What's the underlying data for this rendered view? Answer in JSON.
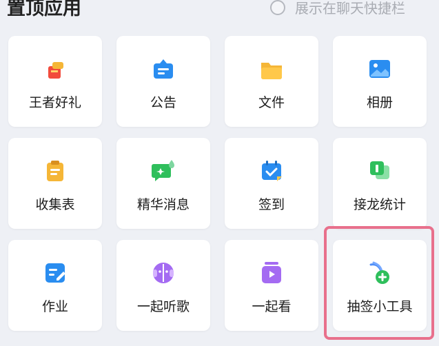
{
  "header": {
    "title": "置顶应用",
    "toggle_label": "展示在聊天快捷栏"
  },
  "apps": [
    {
      "label": "王者好礼",
      "icon": "gift-icon",
      "color": "#f24b3c"
    },
    {
      "label": "公告",
      "icon": "announcement-icon",
      "color": "#2a8df0"
    },
    {
      "label": "文件",
      "icon": "folder-icon",
      "color": "#f5b637"
    },
    {
      "label": "相册",
      "icon": "photo-album-icon",
      "color": "#2a8df0"
    },
    {
      "label": "收集表",
      "icon": "clipboard-icon",
      "color": "#f5b637"
    },
    {
      "label": "精华消息",
      "icon": "highlight-message-icon",
      "color": "#2fbf5c"
    },
    {
      "label": "签到",
      "icon": "calendar-checkin-icon",
      "color": "#2a8df0"
    },
    {
      "label": "接龙统计",
      "icon": "relay-count-icon",
      "color": "#2fbf5c"
    },
    {
      "label": "作业",
      "icon": "homework-icon",
      "color": "#2a8df0"
    },
    {
      "label": "一起听歌",
      "icon": "listen-together-icon",
      "color": "#a46bf2"
    },
    {
      "label": "一起看",
      "icon": "watch-together-icon",
      "color": "#a46bf2"
    },
    {
      "label": "抽签小工具",
      "icon": "lottery-tool-icon",
      "color": "#2fbf5c"
    }
  ],
  "highlight": {
    "target": "抽签小工具",
    "color": "#e8708c"
  }
}
